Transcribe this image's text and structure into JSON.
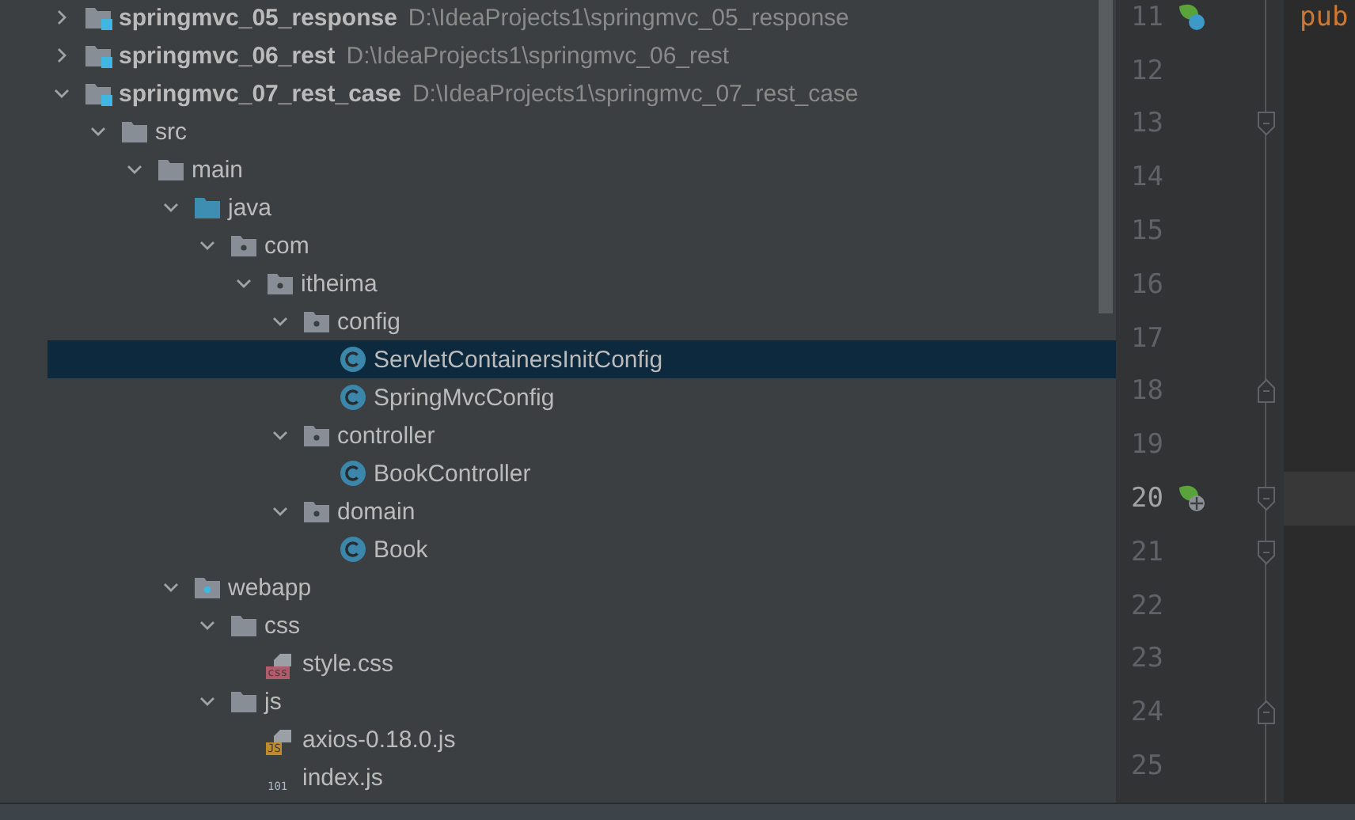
{
  "project_tree": {
    "items": [
      {
        "name": "springmvc_05_response",
        "path": "D:\\IdeaProjects1\\springmvc_05_response",
        "kind": "module",
        "expanded": false,
        "selected": false
      },
      {
        "name": "springmvc_06_rest",
        "path": "D:\\IdeaProjects1\\springmvc_06_rest",
        "kind": "module",
        "expanded": false,
        "selected": false
      },
      {
        "name": "springmvc_07_rest_case",
        "path": "D:\\IdeaProjects1\\springmvc_07_rest_case",
        "kind": "module",
        "expanded": true,
        "selected": false,
        "children": [
          {
            "name": "src",
            "kind": "folder",
            "expanded": true,
            "selected": false,
            "children": [
              {
                "name": "main",
                "kind": "folder",
                "expanded": true,
                "selected": false,
                "children": [
                  {
                    "name": "java",
                    "kind": "source-folder",
                    "expanded": true,
                    "selected": false,
                    "children": [
                      {
                        "name": "com",
                        "kind": "package",
                        "expanded": true,
                        "selected": false,
                        "children": [
                          {
                            "name": "itheima",
                            "kind": "package",
                            "expanded": true,
                            "selected": false,
                            "children": [
                              {
                                "name": "config",
                                "kind": "package",
                                "expanded": true,
                                "selected": false,
                                "children": [
                                  {
                                    "name": "ServletContainersInitConfig",
                                    "kind": "class",
                                    "selected": true
                                  },
                                  {
                                    "name": "SpringMvcConfig",
                                    "kind": "class",
                                    "selected": false
                                  }
                                ]
                              },
                              {
                                "name": "controller",
                                "kind": "package",
                                "expanded": true,
                                "selected": false,
                                "children": [
                                  {
                                    "name": "BookController",
                                    "kind": "class",
                                    "selected": false
                                  }
                                ]
                              },
                              {
                                "name": "domain",
                                "kind": "package",
                                "expanded": true,
                                "selected": false,
                                "children": [
                                  {
                                    "name": "Book",
                                    "kind": "class",
                                    "selected": false
                                  }
                                ]
                              }
                            ]
                          }
                        ]
                      }
                    ]
                  },
                  {
                    "name": "webapp",
                    "kind": "web-folder",
                    "expanded": true,
                    "selected": false,
                    "children": [
                      {
                        "name": "css",
                        "kind": "folder",
                        "expanded": true,
                        "selected": false,
                        "children": [
                          {
                            "name": "style.css",
                            "kind": "css",
                            "badge": "css",
                            "selected": false
                          }
                        ]
                      },
                      {
                        "name": "js",
                        "kind": "folder",
                        "expanded": true,
                        "selected": false,
                        "children": [
                          {
                            "name": "axios-0.18.0.js",
                            "kind": "js",
                            "badge": "JS",
                            "selected": false
                          },
                          {
                            "name": "index.js",
                            "kind": "binary",
                            "badge": "101",
                            "selected": false
                          }
                        ]
                      }
                    ]
                  }
                ]
              }
            ]
          }
        ]
      }
    ]
  },
  "editor": {
    "lines": [
      {
        "number": "11",
        "code": "pub",
        "gutter_icon": {
          "kind": "spring-bean"
        },
        "current": false
      },
      {
        "number": "12",
        "current": false
      },
      {
        "number": "13",
        "fold_marker": {
          "kind": "start"
        },
        "current": false
      },
      {
        "number": "14",
        "current": false
      },
      {
        "number": "15",
        "current": false
      },
      {
        "number": "16",
        "current": false
      },
      {
        "number": "17",
        "current": false
      },
      {
        "number": "18",
        "fold_marker": {
          "kind": "end"
        },
        "current": false
      },
      {
        "number": "19",
        "current": false
      },
      {
        "number": "20",
        "gutter_icon": {
          "kind": "spring-web"
        },
        "fold_marker": {
          "kind": "start"
        },
        "current": true
      },
      {
        "number": "21",
        "fold_marker": {
          "kind": "start"
        },
        "current": false
      },
      {
        "number": "22",
        "current": false
      },
      {
        "number": "23",
        "current": false
      },
      {
        "number": "24",
        "fold_marker": {
          "kind": "end"
        },
        "current": false
      },
      {
        "number": "25",
        "current": false
      }
    ]
  }
}
